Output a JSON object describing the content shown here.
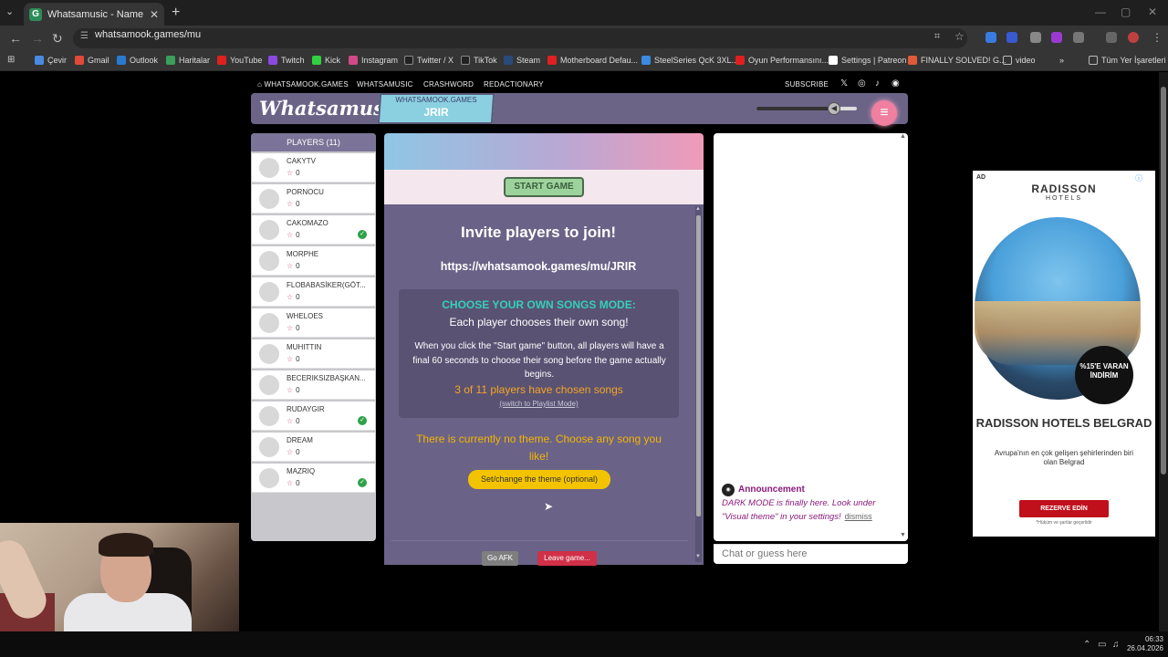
{
  "browser": {
    "tab_title": "Whatsamusic - Name That Tun",
    "url": "whatsamook.games/mu",
    "bookmarks": [
      "Çevir",
      "Gmail",
      "Outlook",
      "Haritalar",
      "YouTube",
      "Twitch",
      "Kick",
      "Instagram",
      "Twitter / X",
      "TikTok",
      "Steam",
      "Motherboard Defau...",
      "SteelSeries QcK 3XL...",
      "Oyun Performansını...",
      "Settings | Patreon",
      "FINALLY SOLVED! G...",
      "video"
    ],
    "all_bookmarks": "Tüm Yer İşaretleri"
  },
  "site_nav": {
    "home": "WHATSAMOOK.GAMES",
    "whatsamusic": "WHATSAMUSIC",
    "crashword": "CRASHWORD",
    "redactionary": "REDACTIONARY",
    "subscribe": "SUBSCRIBE"
  },
  "header": {
    "logo": "Whatsamusic",
    "room_site": "WHATSAMOOK.GAMES",
    "room_code": "JRIR"
  },
  "players": {
    "title": "PLAYERS (11)",
    "list": [
      {
        "name": "CAKYTV",
        "score": "0",
        "chosen": false
      },
      {
        "name": "PORNOCU",
        "score": "0",
        "chosen": false
      },
      {
        "name": "CAKOMAZO",
        "score": "0",
        "chosen": true
      },
      {
        "name": "MORPHE",
        "score": "0",
        "chosen": false
      },
      {
        "name": "FLOBABASİKER(GÖT...",
        "score": "0",
        "chosen": false
      },
      {
        "name": "WHELOES",
        "score": "0",
        "chosen": false
      },
      {
        "name": "MUHITTIN",
        "score": "0",
        "chosen": false
      },
      {
        "name": "BECERIKSIZBAŞKAN...",
        "score": "0",
        "chosen": false
      },
      {
        "name": "RUDAYGIR",
        "score": "0",
        "chosen": true
      },
      {
        "name": "DREAM",
        "score": "0",
        "chosen": false
      },
      {
        "name": "MAZRIQ",
        "score": "0",
        "chosen": true
      }
    ]
  },
  "game": {
    "start_button": "START GAME",
    "invite_title": "Invite players to join!",
    "invite_url": "https://whatsamook.games/mu/JRIR",
    "mode_title": "CHOOSE YOUR OWN SONGS MODE:",
    "mode_subtitle": "Each player chooses their own song!",
    "mode_description": "When you click the \"Start game\" button, all players will have a final 60 seconds to choose their song before the game actually begins.",
    "mode_count": "3 of 11 players have chosen songs",
    "mode_switch": "(switch to Playlist Mode)",
    "theme_text": "There is currently no theme. Choose any song you like!",
    "theme_button": "Set/change the theme (optional)",
    "afk_button": "Go AFK",
    "leave_button": "Leave game..."
  },
  "chat": {
    "announcement_title": "Announcement",
    "announcement_body": "DARK MODE is finally here. Look under \"Visual theme\" in your settings!",
    "dismiss": "dismiss",
    "input_placeholder": "Chat or guess here"
  },
  "ad": {
    "label": "AD",
    "brand": "RADISSON",
    "brand_sub": "HOTELS",
    "badge": "%15'E VARAN İNDİRİM",
    "title": "RADISSON HOTELS BELGRAD",
    "desc": "Avrupa'nın en çok gelişen şehirlerinden biri olan Belgrad",
    "cta": "REZERVE EDİN",
    "fine": "*Hüküm ve şartlar geçerlidir"
  },
  "taskbar": {
    "time": "06:33",
    "date": "26.04.2026"
  },
  "colors": {
    "panel": "#6a6387",
    "accent_pink": "#f07fa0",
    "accent_teal": "#35d0b8",
    "accent_orange": "#f5a623",
    "check_green": "#2fa24a"
  }
}
